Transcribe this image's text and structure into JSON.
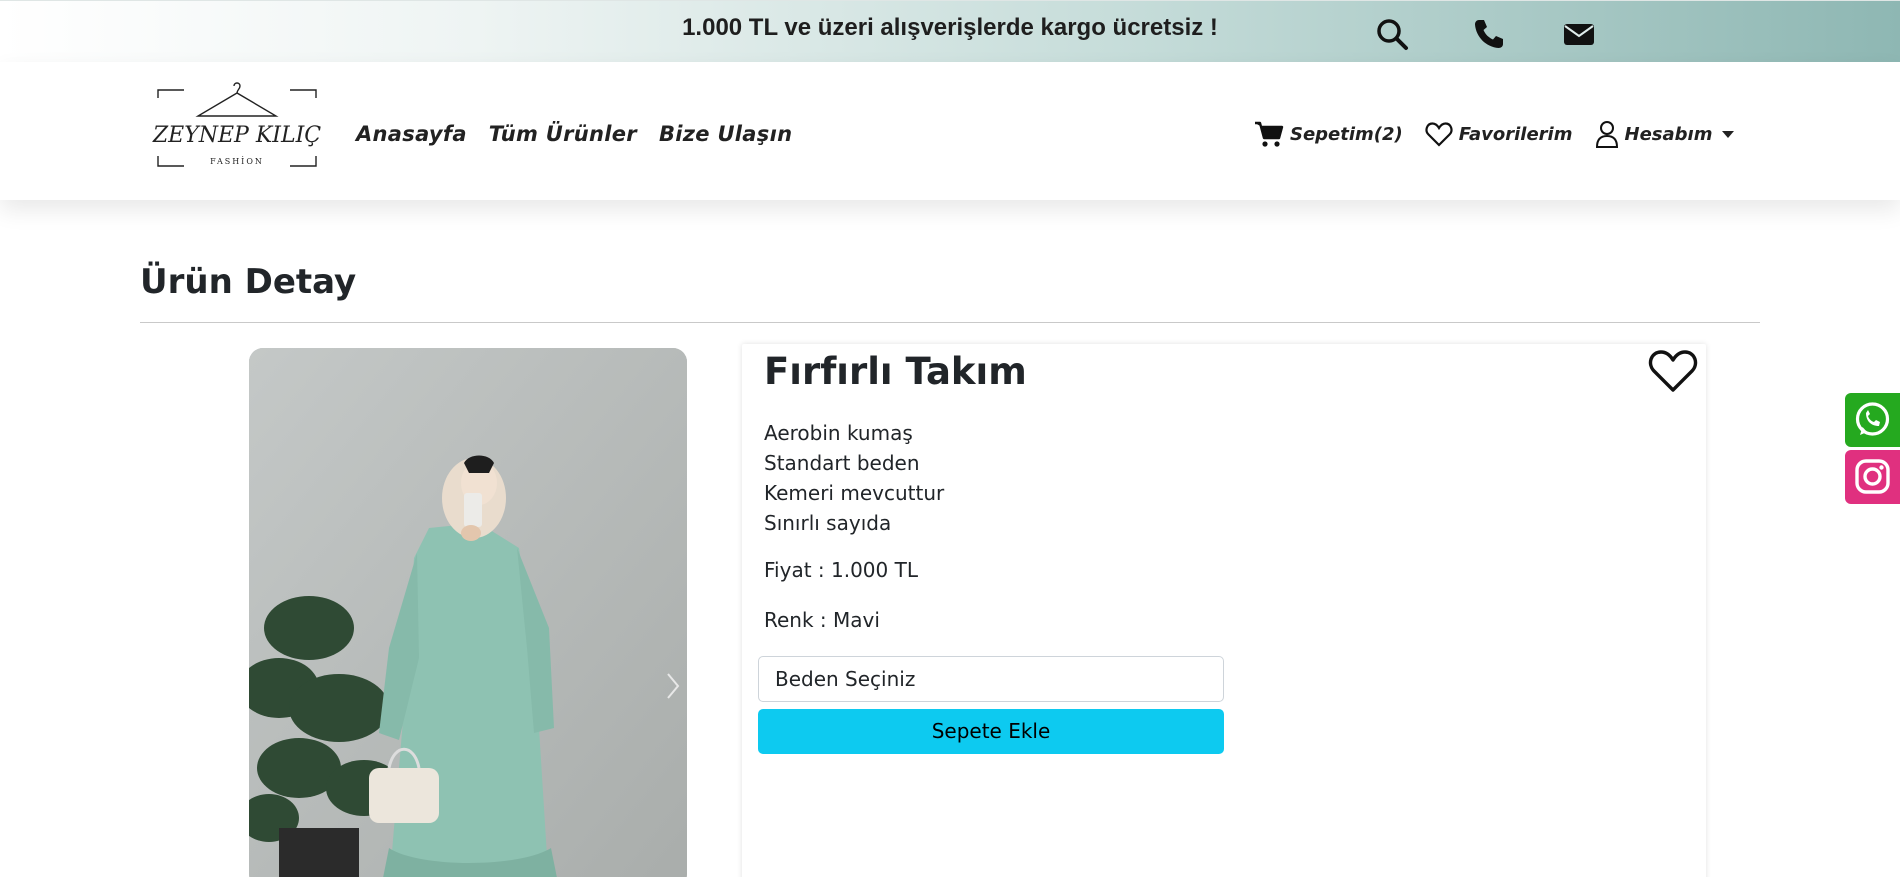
{
  "topbar": {
    "announcement": "1.000 TL ve üzeri alışverişlerde kargo ücretsiz !",
    "icons": [
      "search-icon",
      "phone-icon",
      "mail-icon"
    ]
  },
  "header": {
    "logo": {
      "brand": "ZEYNEP KILIÇ",
      "tagline": "FASHİON"
    },
    "nav": [
      {
        "label": "Anasayfa"
      },
      {
        "label": "Tüm Ürünler"
      },
      {
        "label": "Bize Ulaşın"
      }
    ],
    "cart_label": "Sepetim(2)",
    "favorites_label": "Favorilerim",
    "account_label": "Hesabım"
  },
  "page": {
    "title": "Ürün Detay"
  },
  "product": {
    "name": "Fırfırlı Takım",
    "description": [
      "Aerobin kumaş",
      "Standart beden",
      "Kemeri mevcuttur",
      "Sınırlı sayıda"
    ],
    "price_text": "Fiyat : 1.000 TL",
    "color_text": "Renk : Mavi",
    "size_placeholder": "Beden Seçiniz",
    "add_to_cart_label": "Sepete Ekle"
  },
  "social": [
    "whatsapp-icon",
    "instagram-icon"
  ],
  "colors": {
    "accent_cyan": "#0dcaf0",
    "whatsapp_green": "#25a91f",
    "instagram_pink": "#e0307f",
    "topbar_teal": "#8eb7b3"
  }
}
